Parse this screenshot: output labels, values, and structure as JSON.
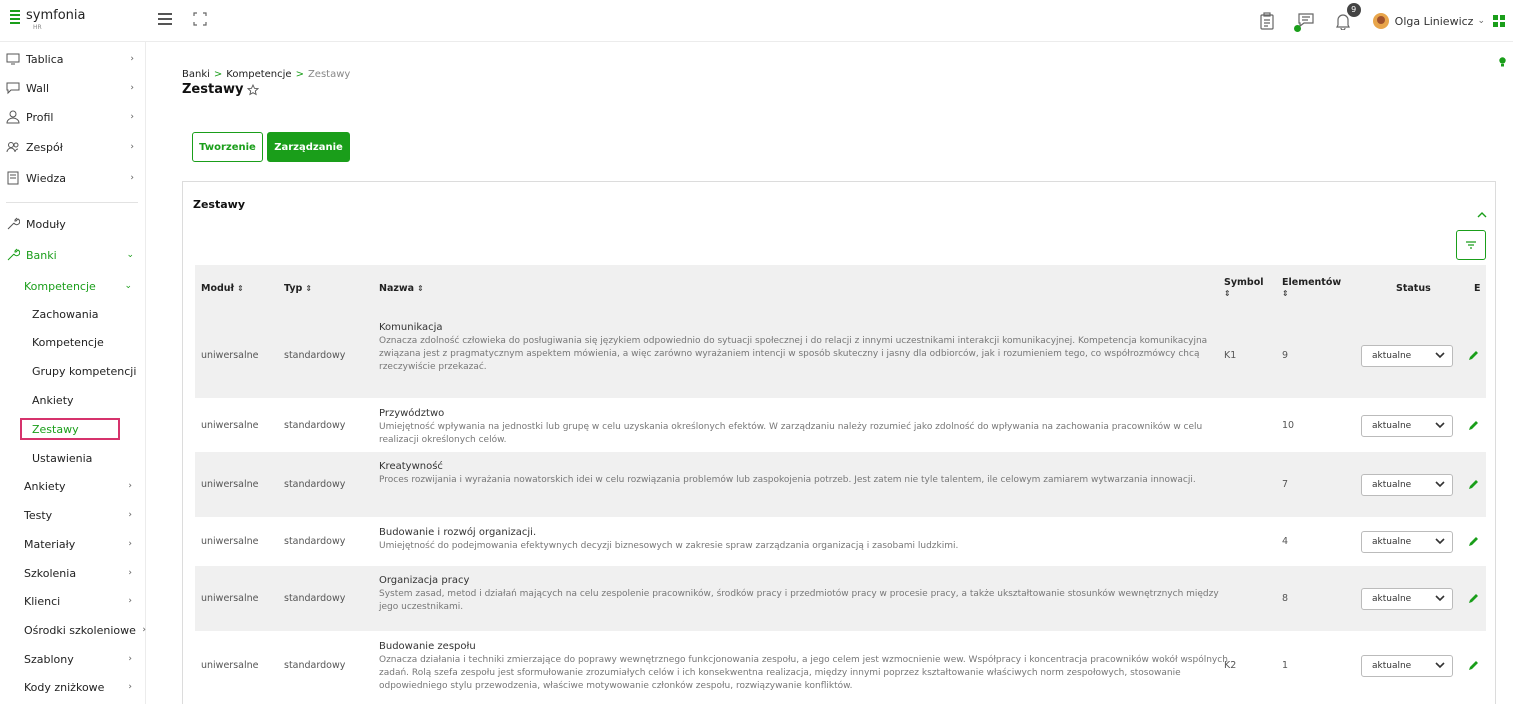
{
  "app": {
    "logo_text": "symfonia",
    "logo_sub": "HR"
  },
  "topbar": {
    "notification_count": "9",
    "user_name": "Olga Liniewicz",
    "user_caret": "⌄"
  },
  "sidebar": {
    "items": [
      {
        "label": "Tablica",
        "icon": "monitor-icon"
      },
      {
        "label": "Wall",
        "icon": "chat-icon"
      },
      {
        "label": "Profil",
        "icon": "user-icon"
      },
      {
        "label": "Zespół",
        "icon": "team-icon"
      },
      {
        "label": "Wiedza",
        "icon": "book-icon"
      },
      {
        "label": "Moduły",
        "icon": "wrench-icon"
      },
      {
        "label": "Banki",
        "icon": "wrench-icon"
      }
    ],
    "banki_sub": [
      {
        "label": "Kompetencje"
      }
    ],
    "kompetencje_sub": [
      {
        "label": "Zachowania"
      },
      {
        "label": "Kompetencje"
      },
      {
        "label": "Grupy kompetencji"
      },
      {
        "label": "Ankiety"
      },
      {
        "label": "Zestawy"
      },
      {
        "label": "Ustawienia"
      }
    ],
    "other_sub": [
      {
        "label": "Ankiety"
      },
      {
        "label": "Testy"
      },
      {
        "label": "Materiały"
      },
      {
        "label": "Szkolenia"
      },
      {
        "label": "Klienci"
      },
      {
        "label": "Ośrodki szkoleniowe"
      },
      {
        "label": "Szablony"
      },
      {
        "label": "Kody zniżkowe"
      }
    ],
    "chevron_right": "›",
    "chevron_down": "⌄"
  },
  "breadcrumb": {
    "part1": "Banki",
    "sep": ">",
    "part2": "Kompetencje",
    "part3": "Zestawy"
  },
  "page": {
    "title": "Zestawy"
  },
  "tabs": {
    "create": "Tworzenie",
    "manage": "Zarządzanie"
  },
  "panel": {
    "title": "Zestawy"
  },
  "table": {
    "headers": {
      "modul": "Moduł",
      "typ": "Typ",
      "nazwa": "Nazwa",
      "symbol": "Symbol",
      "elementow": "Elementów",
      "status": "Status",
      "e": "E"
    },
    "sort_glyph": "⇕",
    "rows": [
      {
        "modul": "uniwersalne",
        "typ": "standardowy",
        "title": "Komunikacja",
        "desc": "Oznacza zdolność człowieka do posługiwania się językiem odpowiednio do sytuacji społecznej i do relacji z innymi uczestnikami interakcji komunikacyjnej. Kompetencja komunikacyjna związana jest z pragmatycznym aspektem mówienia, a więc zarówno wyrażaniem intencji w sposób skuteczny i jasny dla odbiorców, jak i rozumieniem tego, co współrozmówcy chcą rzeczywiście przekazać.",
        "symbol": "K1",
        "count": "9",
        "status": "aktualne"
      },
      {
        "modul": "uniwersalne",
        "typ": "standardowy",
        "title": "Przywództwo",
        "desc": "Umiejętność wpływania na jednostki lub grupę w celu uzyskania określonych efektów. W zarządzaniu należy rozumieć jako zdolność do wpływania na zachowania pracowników w celu realizacji określonych celów.",
        "symbol": "",
        "count": "10",
        "status": "aktualne"
      },
      {
        "modul": "uniwersalne",
        "typ": "standardowy",
        "title": "Kreatywność",
        "desc": "Proces rozwijania i wyrażania nowatorskich idei w celu rozwiązania problemów lub zaspokojenia potrzeb. Jest zatem nie tyle talentem, ile celowym zamiarem wytwarzania innowacji.",
        "symbol": "",
        "count": "7",
        "status": "aktualne"
      },
      {
        "modul": "uniwersalne",
        "typ": "standardowy",
        "title": "Budowanie i rozwój organizacji.",
        "desc": "Umiejętność do podejmowania efektywnych decyzji biznesowych w zakresie spraw zarządzania organizacją i zasobami ludzkimi.",
        "symbol": "",
        "count": "4",
        "status": "aktualne"
      },
      {
        "modul": "uniwersalne",
        "typ": "standardowy",
        "title": "Organizacja pracy",
        "desc": "System zasad, metod i działań mających na celu zespolenie pracowników, środków pracy i przedmiotów pracy w procesie pracy, a także ukształtowanie stosunków wewnętrznych między jego uczestnikami.",
        "symbol": "",
        "count": "8",
        "status": "aktualne"
      },
      {
        "modul": "uniwersalne",
        "typ": "standardowy",
        "title": "Budowanie zespołu",
        "desc": "Oznacza działania i techniki zmierzające do poprawy wewnętrznego funkcjonowania zespołu, a jego celem jest wzmocnienie wew. Współpracy i koncentracja pracowników wokół wspólnych zadań. Rolą szefa zespołu jest sformułowanie zrozumiałych celów i ich konsekwentna realizacja, między innymi poprzez kształtowanie właściwych norm zespołowych, stosowanie odpowiedniego stylu przewodzenia, właściwe motywowanie członków zespołu, rozwiązywanie konfliktów.",
        "symbol": "K2",
        "count": "1",
        "status": "aktualne"
      }
    ]
  },
  "colors": {
    "accent": "#1a9e1a",
    "highlight": "#d6336c",
    "row_alt": "#f0f0f0"
  }
}
